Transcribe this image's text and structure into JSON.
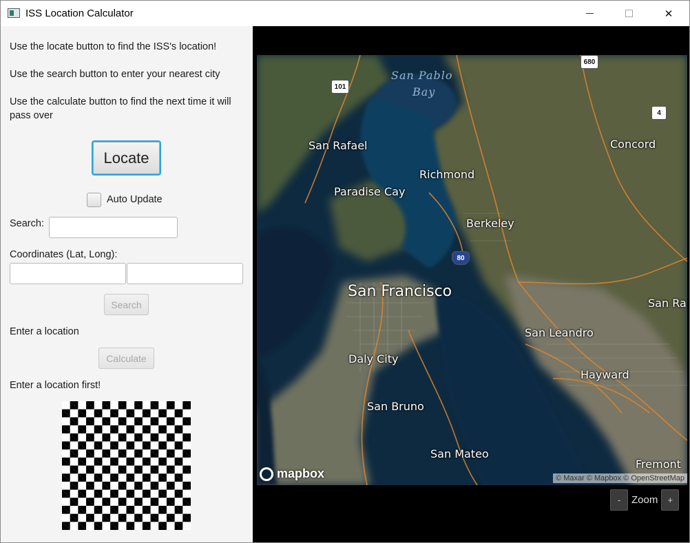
{
  "window": {
    "title": "ISS Location Calculator",
    "minimize_icon": "minimize-icon",
    "maximize_icon": "maximize-icon",
    "close_label": "✕"
  },
  "instructions": {
    "locate": "Use the locate button to find the ISS's location!",
    "search": "Use the search button to enter your nearest city",
    "calculate": "Use the calculate button to find the next time it will pass over"
  },
  "controls": {
    "locate_label": "Locate",
    "auto_update_label": "Auto Update",
    "auto_update_checked": false,
    "search_label": "Search:",
    "search_value": "",
    "coordinates_label": "Coordinates (Lat, Long):",
    "latitude_value": "",
    "longitude_value": "",
    "search_button_label": "Search",
    "enter_location_text": "Enter a location",
    "calculate_button_label": "Calculate",
    "location_first_text": "Enter a location first!"
  },
  "map": {
    "water_labels": [
      "San Pablo",
      "Bay"
    ],
    "places": [
      {
        "name": "San Rafael",
        "size": "medium"
      },
      {
        "name": "Richmond",
        "size": "medium"
      },
      {
        "name": "Concord",
        "size": "medium"
      },
      {
        "name": "Paradise Cay",
        "size": "medium"
      },
      {
        "name": "Berkeley",
        "size": "medium"
      },
      {
        "name": "San Francisco",
        "size": "large"
      },
      {
        "name": "San Ra",
        "size": "medium"
      },
      {
        "name": "San Leandro",
        "size": "medium"
      },
      {
        "name": "Daly City",
        "size": "medium"
      },
      {
        "name": "Hayward",
        "size": "medium"
      },
      {
        "name": "San Bruno",
        "size": "medium"
      },
      {
        "name": "San Mateo",
        "size": "medium"
      },
      {
        "name": "Fremont",
        "size": "medium"
      }
    ],
    "shields": [
      "680",
      "101",
      "4",
      "80"
    ],
    "logo_text": "mapbox",
    "attribution": "© Maxar © Mapbox © OpenStreetMap",
    "colors": {
      "water": "#0f2a3f",
      "land": "#3d4a36",
      "roads": "#e0872f"
    }
  },
  "zoom": {
    "minus_label": "-",
    "label": "Zoom",
    "plus_label": "+"
  }
}
